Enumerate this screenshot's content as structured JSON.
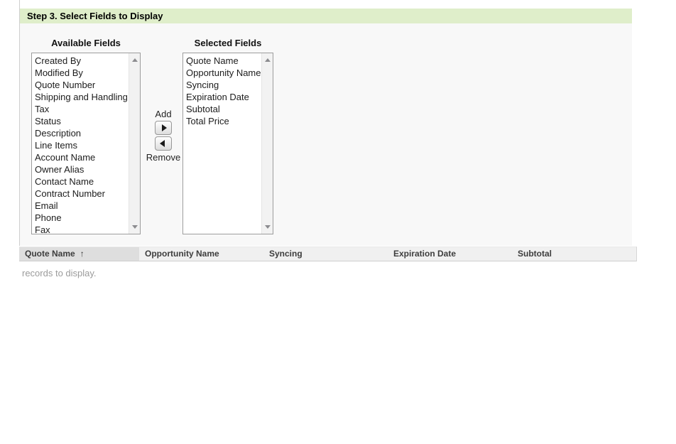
{
  "page": {
    "step_title": "Step 3. Select Fields to Display"
  },
  "field_selector": {
    "available": {
      "label": "Available Fields",
      "items": [
        "Created By",
        "Modified By",
        "Quote Number",
        "Shipping and Handling",
        "Tax",
        "Status",
        "Description",
        "Line Items",
        "Account Name",
        "Owner Alias",
        "Contact Name",
        "Contract Number",
        "Email",
        "Phone",
        "Fax"
      ]
    },
    "selected": {
      "label": "Selected Fields",
      "items": [
        "Quote Name",
        "Opportunity Name",
        "Syncing",
        "Expiration Date",
        "Subtotal",
        "Total Price"
      ]
    },
    "add_label": "Add",
    "remove_label": "Remove"
  },
  "preview_table": {
    "columns": [
      {
        "label": "Quote Name",
        "sorted": true,
        "sort_arrow": "↑"
      },
      {
        "label": "Opportunity Name"
      },
      {
        "label": "Syncing"
      },
      {
        "label": "Expiration Date"
      },
      {
        "label": "Subtotal"
      }
    ],
    "empty_text": "records to display."
  },
  "colors": {
    "step_header_bg": "#dfeeca",
    "content_bg": "#f8f8f8",
    "sorted_column_bg": "#dedede",
    "header_row_bg": "#f0f0f0"
  }
}
